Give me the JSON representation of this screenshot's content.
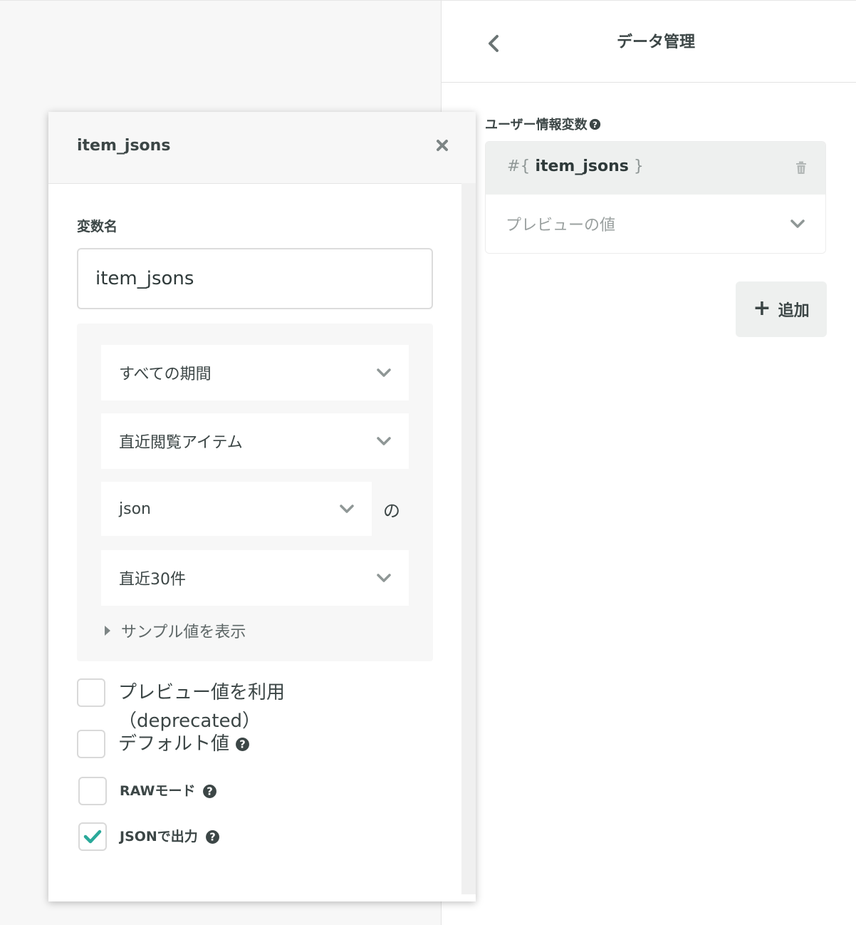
{
  "right_panel": {
    "title": "データ管理",
    "section_label": "ユーザー情報変数",
    "variable": {
      "prefix": "#{",
      "name": "item_jsons",
      "suffix": "}"
    },
    "preview_placeholder": "プレビューの値",
    "add_button": "追加"
  },
  "modal": {
    "title": "item_jsons",
    "variable_name_label": "変数名",
    "variable_name_value": "item_jsons",
    "selects": {
      "period": "すべての期間",
      "source": "直近閲覧アイテム",
      "field": "json",
      "field_suffix": "の",
      "limit": "直近30件"
    },
    "sample_toggle": "サンプル値を表示",
    "checkboxes": {
      "use_preview": {
        "label": "プレビュー値を利用（deprecated）",
        "checked": false
      },
      "default_value": {
        "label": "デフォルト値",
        "checked": false
      },
      "raw_mode": {
        "label": "RAWモード",
        "checked": false
      },
      "json_output": {
        "label": "JSONで出力",
        "checked": true
      }
    }
  },
  "colors": {
    "accent_check": "#2aa99a",
    "text_dark": "#3c4646",
    "icon_gray": "#8f9796"
  },
  "icons": [
    "back-chevron-icon",
    "help-icon",
    "trash-icon",
    "chevron-down-icon",
    "plus-icon",
    "close-icon",
    "caret-right-icon",
    "checkmark-icon"
  ]
}
